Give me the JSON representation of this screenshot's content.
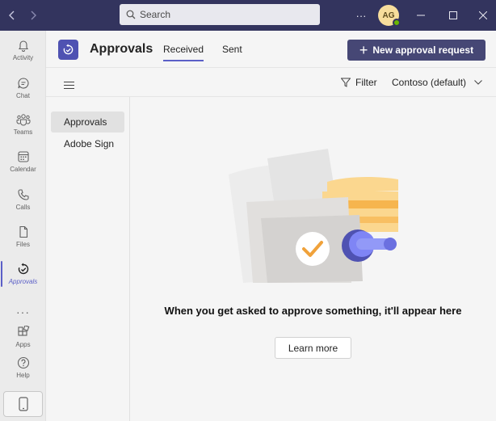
{
  "titlebar": {
    "search_placeholder": "Search",
    "avatar_initials": "AG",
    "more_label": "···"
  },
  "rail": {
    "items": [
      {
        "label": "Activity",
        "icon": "bell-icon"
      },
      {
        "label": "Chat",
        "icon": "chat-icon"
      },
      {
        "label": "Teams",
        "icon": "teams-icon"
      },
      {
        "label": "Calendar",
        "icon": "calendar-icon"
      },
      {
        "label": "Calls",
        "icon": "phone-icon"
      },
      {
        "label": "Files",
        "icon": "file-icon"
      },
      {
        "label": "Approvals",
        "icon": "approvals-icon",
        "active": true
      },
      {
        "label": "Apps",
        "icon": "apps-icon"
      },
      {
        "label": "Help",
        "icon": "help-icon"
      }
    ],
    "more": "···"
  },
  "header": {
    "title": "Approvals",
    "tabs": [
      {
        "label": "Received",
        "active": true
      },
      {
        "label": "Sent",
        "active": false
      }
    ],
    "new_button": "New approval request"
  },
  "toolbar": {
    "filter_label": "Filter",
    "tenant_label": "Contoso (default)"
  },
  "leftnav": {
    "items": [
      {
        "label": "Approvals",
        "active": true
      },
      {
        "label": "Adobe Sign",
        "active": false
      }
    ]
  },
  "main": {
    "empty_message": "When you get asked to approve something, it'll appear here",
    "learn_more": "Learn more"
  },
  "colors": {
    "titlebar": "#33345e",
    "accent": "#5b5fc7",
    "primary_button": "#464775"
  }
}
